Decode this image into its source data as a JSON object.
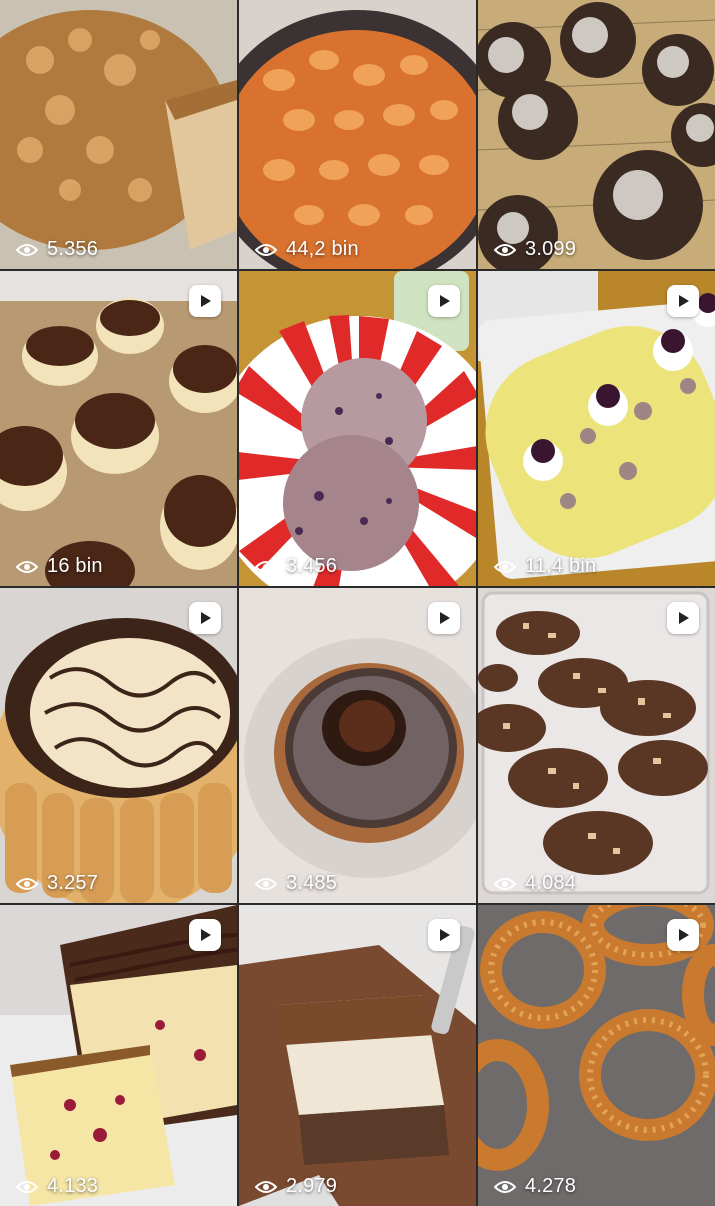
{
  "grid": {
    "posts": [
      {
        "subject": "crumble apple cake",
        "views": "5.356",
        "reel": false
      },
      {
        "subject": "pasta shells in tomato sauce",
        "views": "44,2 bin",
        "reel": false
      },
      {
        "subject": "chocolate crinkle cookies",
        "views": "3.099",
        "reel": false
      },
      {
        "subject": "chocolate cream puffs",
        "views": "16 bin",
        "reel": true
      },
      {
        "subject": "blueberry cookies",
        "views": "3.456",
        "reel": true
      },
      {
        "subject": "berry cream roll cake",
        "views": "11,4 bin",
        "reel": true
      },
      {
        "subject": "charlotte cake with chocolate drizzle",
        "views": "3.257",
        "reel": true
      },
      {
        "subject": "lava chocolate cake",
        "views": "3.485",
        "reel": true
      },
      {
        "subject": "chocolate biscuit salami",
        "views": "4.084",
        "reel": true
      },
      {
        "subject": "berry loaf cake",
        "views": "4.133",
        "reel": true
      },
      {
        "subject": "tiramisu slice",
        "views": "2.979",
        "reel": true
      },
      {
        "subject": "simit sesame bread rings",
        "views": "4.278",
        "reel": true
      }
    ]
  },
  "icons": {
    "views": "eye-icon",
    "reel": "play-icon"
  },
  "colors": {
    "background": "#2a2a2a",
    "overlay_text": "#ffffff"
  }
}
